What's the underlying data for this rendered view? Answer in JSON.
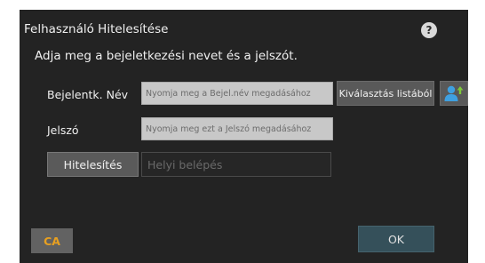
{
  "dialog": {
    "title": "Felhasználó Hitelesítése",
    "subtitle": "Adja meg a bejeletkezési nevet és a jelszót.",
    "help_icon": "question-mark-icon"
  },
  "login_name": {
    "label": "Bejelentk. Név",
    "placeholder": "Nyomja meg a Bejel.név megadásához",
    "select_button": "Kiválasztás listából",
    "user_button_icon": "user-add-icon"
  },
  "password": {
    "label": "Jelszó",
    "placeholder": "Nyomja meg ezt a Jelszó megadásához"
  },
  "auth": {
    "button_label": "Hitelesítés",
    "method_value": "Helyi belépés"
  },
  "footer": {
    "ca_label": "CA",
    "ok_label": "OK"
  },
  "colors": {
    "dialog_background": "#232323",
    "ca_text": "#e8a020",
    "ok_button": "#35505a",
    "user_icon": "#3fa0e0"
  }
}
